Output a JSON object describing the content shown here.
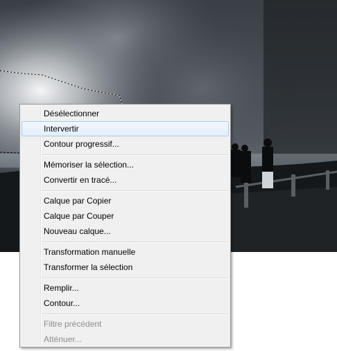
{
  "menu": {
    "items": [
      {
        "label": "Désélectionner"
      },
      {
        "label": "Intervertir"
      },
      {
        "label": "Contour progressif..."
      },
      {
        "label": "Mémoriser la sélection..."
      },
      {
        "label": "Convertir en tracé..."
      },
      {
        "label": "Calque par Copier"
      },
      {
        "label": "Calque par Couper"
      },
      {
        "label": "Nouveau calque..."
      },
      {
        "label": "Transformation manuelle"
      },
      {
        "label": "Transformer la sélection"
      },
      {
        "label": "Remplir..."
      },
      {
        "label": "Contour..."
      },
      {
        "label": "Filtre précédent"
      },
      {
        "label": "Atténuer..."
      }
    ],
    "highlighted_item": "Intervertir",
    "disabled_items": [
      "Filtre précédent",
      "Atténuer..."
    ]
  },
  "colors": {
    "menu_background": "#f0f0f0",
    "highlight_border": "#a8c8ef",
    "disabled_text": "#8d8d8d"
  }
}
